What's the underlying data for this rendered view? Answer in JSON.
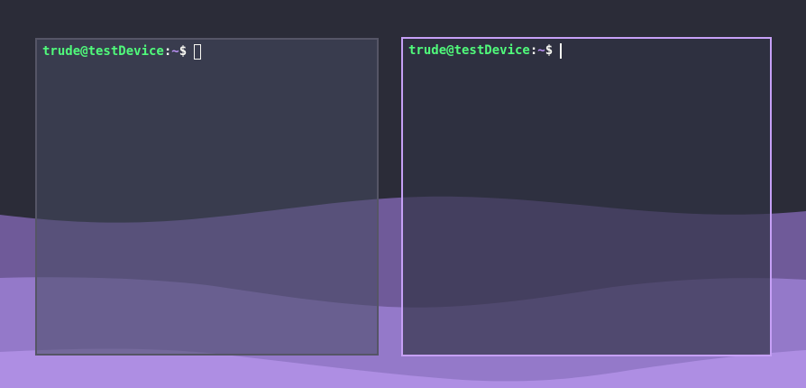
{
  "desktop": {
    "background_color": "#2b2c38",
    "wave_colors": [
      "#7b63a8",
      "#9a7ed0",
      "#b08ee4"
    ]
  },
  "terminals": [
    {
      "state": "inactive",
      "user_host": "trude@testDevice",
      "separator": ":",
      "path": "~",
      "symbol": "$",
      "cursor": "block-outline",
      "border_color": "#555566"
    },
    {
      "state": "focused",
      "user_host": "trude@testDevice",
      "separator": ":",
      "path": "~",
      "symbol": "$",
      "cursor": "bar",
      "border_color": "#c6a0f6"
    }
  ],
  "colors": {
    "user_host": "#50fa7b",
    "path": "#bd93f9",
    "text": "#f8f8f2"
  }
}
